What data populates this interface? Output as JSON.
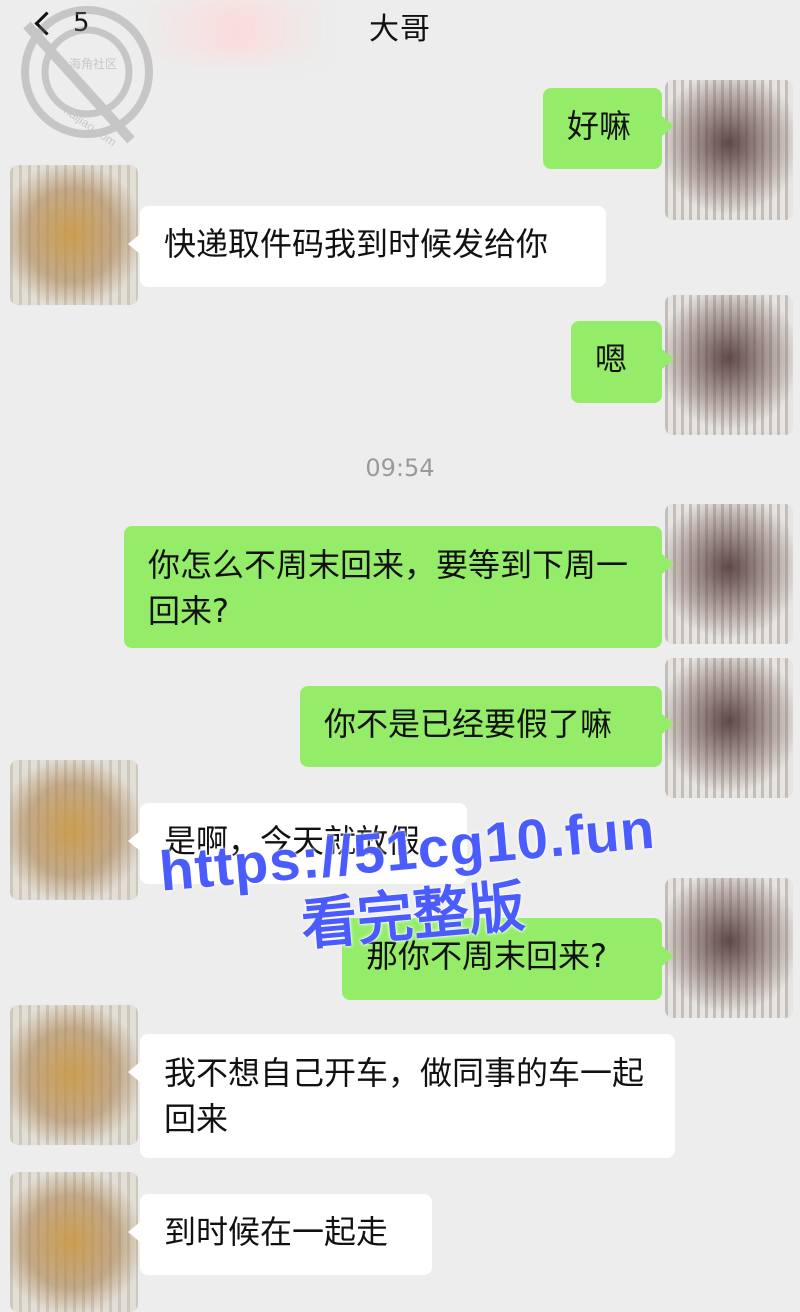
{
  "header": {
    "unread_count": "5",
    "title": "大哥",
    "back_icon": "chevron-left-icon"
  },
  "watermark": {
    "line1": "海角社区",
    "line2": "haijiao.com"
  },
  "messages": [
    {
      "id": "m1",
      "from": "me",
      "text": "好嘛"
    },
    {
      "id": "m2",
      "from": "other",
      "text": "快递取件码我到时候发给你"
    },
    {
      "id": "m3",
      "from": "me",
      "text": "嗯"
    },
    {
      "id": "m4",
      "from": "me",
      "text": "你怎么不周末回来，要等到下周一回来?"
    },
    {
      "id": "m5",
      "from": "me",
      "text": "你不是已经要假了嘛"
    },
    {
      "id": "m6",
      "from": "other",
      "text": "是啊，今天就放假"
    },
    {
      "id": "m7",
      "from": "me",
      "text": "那你不周末回来?"
    },
    {
      "id": "m8",
      "from": "other",
      "text": "我不想自己开车，做同事的车一起回来"
    },
    {
      "id": "m9",
      "from": "other",
      "text": "到时候在一起走"
    }
  ],
  "time_divider": "09:54",
  "promo": {
    "url": "https://51cg10.fun",
    "label": "看完整版"
  },
  "colors": {
    "background": "#ededed",
    "my_bubble": "#95ec69",
    "their_bubble": "#ffffff",
    "timestamp": "#9a9a9a",
    "promo_text": "#4b5cff"
  }
}
